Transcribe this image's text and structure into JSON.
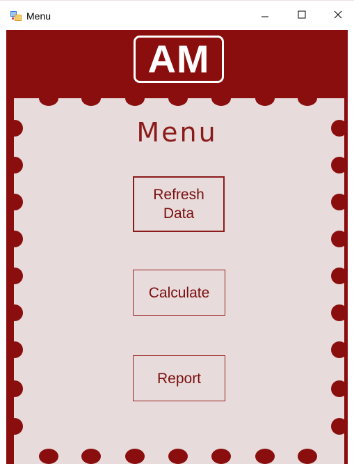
{
  "window": {
    "title": "Menu",
    "controls": {
      "minimize_icon": "minimize-icon",
      "maximize_icon": "maximize-icon",
      "close_icon": "close-icon"
    }
  },
  "logo": {
    "text": "AM"
  },
  "menu": {
    "title": "Menu",
    "buttons": [
      {
        "line1": "Refresh",
        "line2": "Data"
      },
      {
        "label": "Calculate"
      },
      {
        "label": "Report"
      }
    ]
  },
  "colors": {
    "frame": "#8b0e0e",
    "panel": "#e7dbdb",
    "accent_text": "#8b1a1a"
  }
}
